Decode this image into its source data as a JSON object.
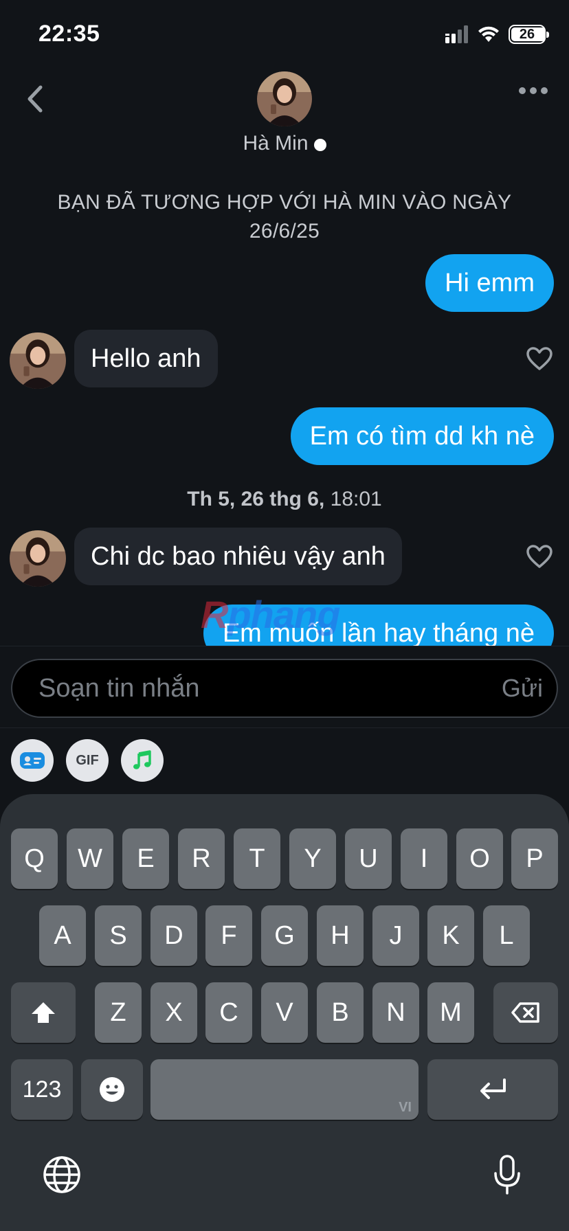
{
  "status": {
    "time": "22:35",
    "battery_level": "26"
  },
  "header": {
    "contact_name": "Hà Min"
  },
  "match_note": "BẠN ĐÃ TƯƠNG HỢP VỚI HÀ MIN VÀO NGÀY 26/6/25",
  "messages": [
    {
      "direction": "out",
      "text": "Hi emm"
    },
    {
      "direction": "in",
      "text": "Hello anh"
    },
    {
      "direction": "out",
      "text": "Em có tìm dd kh nè"
    },
    {
      "direction": "in",
      "text": "Chi dc bao nhiêu vậy anh"
    },
    {
      "direction": "out",
      "text": "Em muốn lần hay tháng nè"
    }
  ],
  "timestamp": {
    "date": "Th 5, 26 thg 6,",
    "time": "18:01"
  },
  "watermark": {
    "part1": "R",
    "part2": "phang"
  },
  "composer": {
    "placeholder": "Soạn tin nhắn",
    "send_label": "Gửi"
  },
  "attachments": {
    "gif_label": "GIF"
  },
  "keyboard": {
    "row1": [
      "Q",
      "W",
      "E",
      "R",
      "T",
      "Y",
      "U",
      "I",
      "O",
      "P"
    ],
    "row2": [
      "A",
      "S",
      "D",
      "F",
      "G",
      "H",
      "J",
      "K",
      "L"
    ],
    "row3": [
      "Z",
      "X",
      "C",
      "V",
      "B",
      "N",
      "M"
    ],
    "numbers_label": "123",
    "space_lang": "VI"
  },
  "colors": {
    "outgoing_bubble": "#12a3f0",
    "incoming_bubble": "#22262d",
    "background": "#111418"
  }
}
